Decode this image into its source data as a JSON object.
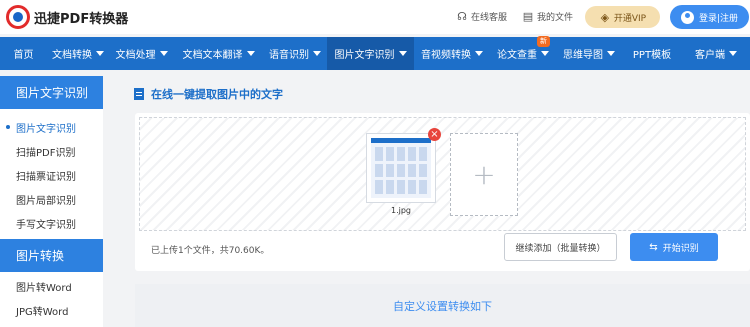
{
  "header": {
    "brand": "迅捷PDF转换器",
    "service_label": "在线客服",
    "files_label": "我的文件",
    "vip_label": "开通VIP",
    "login_label": "登录|注册"
  },
  "nav": {
    "items": [
      {
        "label": "首页",
        "caret": false
      },
      {
        "label": "文档转换",
        "caret": true
      },
      {
        "label": "文档处理",
        "caret": true
      },
      {
        "label": "文档文本翻译",
        "caret": true
      },
      {
        "label": "语音识别",
        "caret": true
      },
      {
        "label": "图片文字识别",
        "caret": true,
        "active": true
      },
      {
        "label": "音视频转换",
        "caret": true
      },
      {
        "label": "论文查重",
        "caret": true,
        "badge": "新"
      },
      {
        "label": "思维导图",
        "caret": true
      },
      {
        "label": "PPT模板",
        "caret": false
      },
      {
        "label": "客户端",
        "caret": true
      }
    ]
  },
  "sidebar": {
    "group1_title": "图片文字识别",
    "group1_items": [
      "图片文字识别",
      "扫描PDF识别",
      "扫描票证识别",
      "图片局部识别",
      "手写文字识别"
    ],
    "group2_title": "图片转换",
    "group2_items": [
      "图片转Word",
      "JPG转Word"
    ]
  },
  "main": {
    "title": "在线一键提取图片中的文字",
    "file_name": "1.jpg",
    "close_glyph": "×",
    "plus_glyph": "+",
    "status_text": "已上传1个文件，共70.60K。",
    "continue_label": "继续添加（批量转换）",
    "start_label": "开始识别",
    "settings_text": "自定义设置转换如下"
  },
  "colors": {
    "nav_blue": "#1d6fc9",
    "accent_blue": "#3d8df0",
    "vip_gold": "#f5dfb0",
    "badge_orange": "#f36b21",
    "close_red": "#e8453c"
  },
  "icons": {
    "headset": "headset-icon",
    "files": "file-icon",
    "vip": "diamond-icon",
    "user": "user-icon",
    "doc": "document-icon",
    "swap": "swap-icon"
  }
}
